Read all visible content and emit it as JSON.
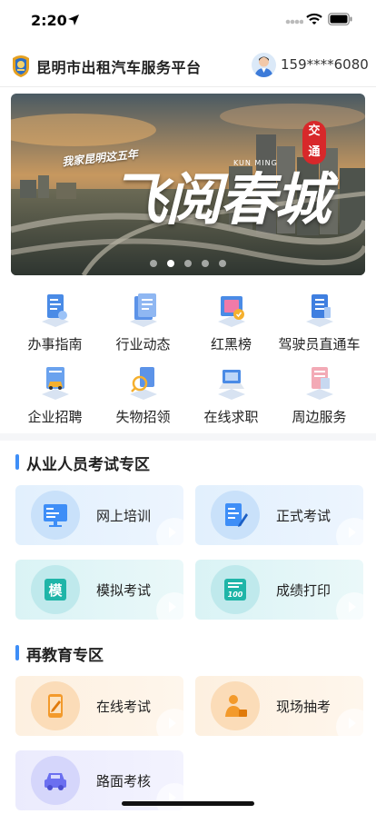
{
  "status_bar": {
    "time": "2:20"
  },
  "header": {
    "title": "昆明市出租汽车服务平台",
    "phone": "159****6080"
  },
  "banner": {
    "line1": "我家昆明这五年",
    "line2": "阅春城",
    "prefix": "飞",
    "english": "KUN MING",
    "seal": [
      "交",
      "通"
    ],
    "slides": 5,
    "active_slide": 2
  },
  "quick_menu": [
    {
      "label": "办事指南",
      "icon": "guide-doc-icon"
    },
    {
      "label": "行业动态",
      "icon": "news-doc-icon"
    },
    {
      "label": "红黑榜",
      "icon": "board-icon"
    },
    {
      "label": "驾驶员直通车",
      "icon": "driver-list-icon"
    },
    {
      "label": "企业招聘",
      "icon": "recruit-car-icon"
    },
    {
      "label": "失物招领",
      "icon": "lost-found-icon"
    },
    {
      "label": "在线求职",
      "icon": "job-laptop-icon"
    },
    {
      "label": "周边服务",
      "icon": "nearby-map-icon"
    }
  ],
  "exam_section": {
    "title": "从业人员考试专区",
    "cards": [
      {
        "label": "网上培训",
        "icon": "online-training-icon",
        "color": "blue"
      },
      {
        "label": "正式考试",
        "icon": "formal-exam-icon",
        "color": "blue"
      },
      {
        "label": "模拟考试",
        "icon": "mock-exam-icon",
        "color": "cyan"
      },
      {
        "label": "成绩打印",
        "icon": "score-print-icon",
        "color": "cyan"
      }
    ]
  },
  "reeducation_section": {
    "title": "再教育专区",
    "cards": [
      {
        "label": "在线考试",
        "icon": "online-exam-icon",
        "color": "orange"
      },
      {
        "label": "现场抽考",
        "icon": "onsite-exam-icon",
        "color": "orange"
      },
      {
        "label": "路面考核",
        "icon": "road-test-icon",
        "color": "purple"
      }
    ]
  },
  "colors": {
    "accent": "#3e8ef7",
    "seal_red": "#d8282a"
  }
}
